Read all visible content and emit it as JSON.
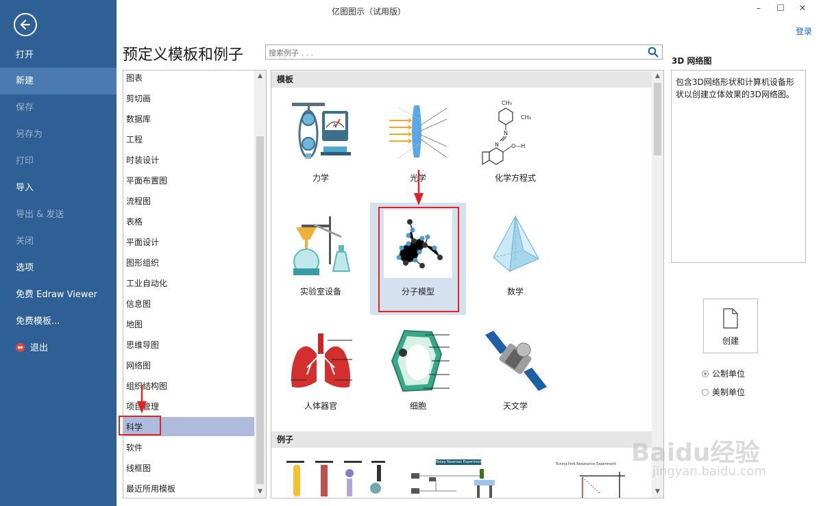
{
  "window": {
    "title": "亿图图示（试用版）",
    "login": "登录",
    "controls": [
      "–",
      "☐",
      "✕"
    ]
  },
  "sidebar": {
    "items": [
      {
        "label": "打开",
        "enabled": true
      },
      {
        "label": "新建",
        "enabled": true,
        "active": true
      },
      {
        "label": "保存",
        "enabled": false
      },
      {
        "label": "另存为",
        "enabled": false
      },
      {
        "label": "打印",
        "enabled": false
      },
      {
        "label": "导入",
        "enabled": true
      },
      {
        "label": "导出 & 发送",
        "enabled": false
      },
      {
        "label": "关闭",
        "enabled": false
      },
      {
        "label": "选项",
        "enabled": true
      },
      {
        "label": "免费 Edraw Viewer",
        "enabled": true
      },
      {
        "label": "免费模板...",
        "enabled": true
      },
      {
        "label": "退出",
        "enabled": true
      }
    ]
  },
  "header": {
    "title": "预定义模板和例子",
    "search_placeholder": "搜索例子 . . ."
  },
  "categories": {
    "items": [
      "图表",
      "剪切画",
      "数据库",
      "工程",
      "时装设计",
      "平面布置图",
      "流程图",
      "表格",
      "平面设计",
      "图形组织",
      "工业自动化",
      "信息图",
      "地图",
      "思维导图",
      "网络图",
      "组织结构图",
      "项目管理",
      "科学",
      "软件",
      "线框图",
      "最近所用模板"
    ],
    "selected": "科学"
  },
  "gallery": {
    "templates_header": "模板",
    "examples_header": "例子",
    "templates": [
      {
        "label": "力学",
        "icon": "mechanics-icon"
      },
      {
        "label": "光学",
        "icon": "optics-icon"
      },
      {
        "label": "化学方程式",
        "icon": "chemical-formula-icon"
      },
      {
        "label": "实验室设备",
        "icon": "lab-equipment-icon"
      },
      {
        "label": "分子模型",
        "icon": "molecule-icon",
        "selected": true
      },
      {
        "label": "数学",
        "icon": "pyramid-icon"
      },
      {
        "label": "人体器官",
        "icon": "lungs-icon"
      },
      {
        "label": "细胞",
        "icon": "cell-icon"
      },
      {
        "label": "天文学",
        "icon": "satellite-icon"
      }
    ],
    "chem_labels": {
      "ch3_a": "CH₃",
      "ch3_b": "CH₃",
      "n1": "N",
      "n2": "N",
      "oh": "O—H"
    },
    "example_captions": {
      "ex2": "Today Newman Experiment",
      "ex3": "Tuning Fork Resonance Experiment"
    }
  },
  "detail": {
    "title": "3D 网络图",
    "description": "包含3D网络形状和计算机设备形状以创建立体效果的3D网络图。",
    "create_label": "创建",
    "units": [
      {
        "label": "公制单位",
        "selected": true
      },
      {
        "label": "美制单位",
        "selected": false
      }
    ]
  },
  "watermark": {
    "text": "Baidu经验",
    "url": "jingyan.baidu.com"
  },
  "colors": {
    "sidebar": "#2e5f95",
    "sidebar_active": "#4a7bb0",
    "selected_category": "#aebbdc",
    "annotation": "#e02424",
    "link": "#1565c0"
  }
}
